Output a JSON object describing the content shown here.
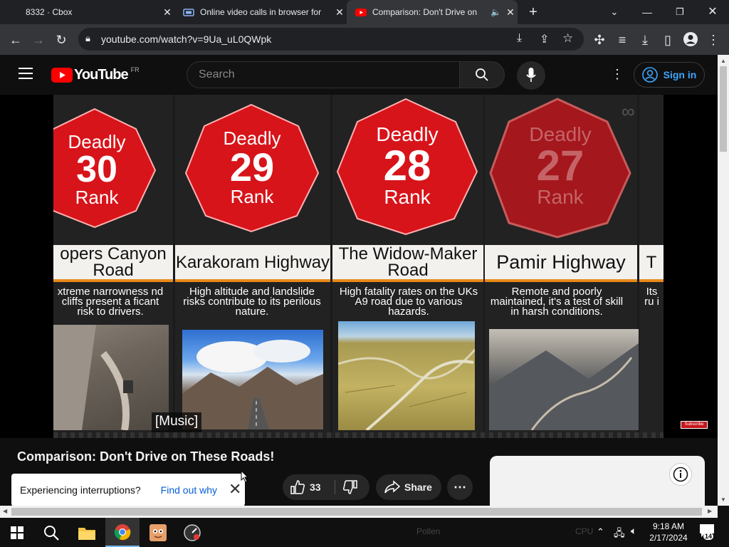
{
  "browser": {
    "tabs": [
      {
        "label": "8332 · Cbox",
        "active": false
      },
      {
        "label": "Online video calls in browser for",
        "active": false
      },
      {
        "label": "Comparison: Don't Drive on",
        "active": true
      }
    ],
    "url": "youtube.com/watch?v=9Ua_uL0QWpk"
  },
  "youtube": {
    "logo_text": "YouTube",
    "region": "FR",
    "search_placeholder": "Search",
    "signin_label": "Sign in"
  },
  "video": {
    "cards": [
      {
        "badge_top": "Deadly",
        "rank": "30",
        "badge_bottom": "Rank",
        "title": "opers Canyon Road",
        "description": "xtreme narrowness nd cliffs present a ficant risk to drivers."
      },
      {
        "badge_top": "Deadly",
        "rank": "29",
        "badge_bottom": "Rank",
        "title": "Karakoram Highway",
        "description": "High altitude and landslide risks contribute to its perilous nature."
      },
      {
        "badge_top": "Deadly",
        "rank": "28",
        "badge_bottom": "Rank",
        "title": "The Widow-Maker Road",
        "description": "High fatality rates on the UKs A9 road due to various hazards."
      },
      {
        "badge_top": "Deadly",
        "rank": "27",
        "badge_bottom": "Rank",
        "title": "Pamir Highway",
        "description": "Remote and poorly maintained, it's a test of skill in harsh conditions."
      },
      {
        "badge_top": "",
        "rank": "",
        "badge_bottom": "",
        "title": "T",
        "description": "Its ru i"
      }
    ],
    "caption": "[Music]",
    "watermark": "Subscribe",
    "badge_color": "#d7141a",
    "accent_color": "#e88a1a"
  },
  "below": {
    "title": "Comparison: Don't Drive on These Roads!",
    "toast_text": "Experiencing interruptions?",
    "toast_link": "Find out why",
    "like_count": "33",
    "share_label": "Share"
  },
  "taskbar": {
    "time": "9:18 AM",
    "date": "2/17/2024",
    "notifications": "14",
    "faded_tray": [
      "Pollen",
      "CPU"
    ]
  }
}
